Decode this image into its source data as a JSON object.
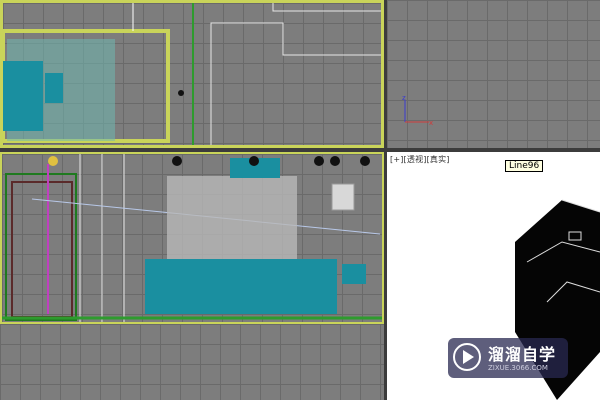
{
  "viewports": {
    "perspective": {
      "label": "[+][透视][真实]",
      "tooltip": "Line96"
    }
  },
  "watermark": {
    "name": "溜溜自学",
    "url": "ZIXUE.3066.COM"
  },
  "colors": {
    "viewport_bg": "#7d7d7d",
    "grid_line": "#6a6a6a",
    "active_border": "#c9d45a",
    "model_cyan": "#1a8fa0",
    "perspective_bg": "#ffffff"
  }
}
